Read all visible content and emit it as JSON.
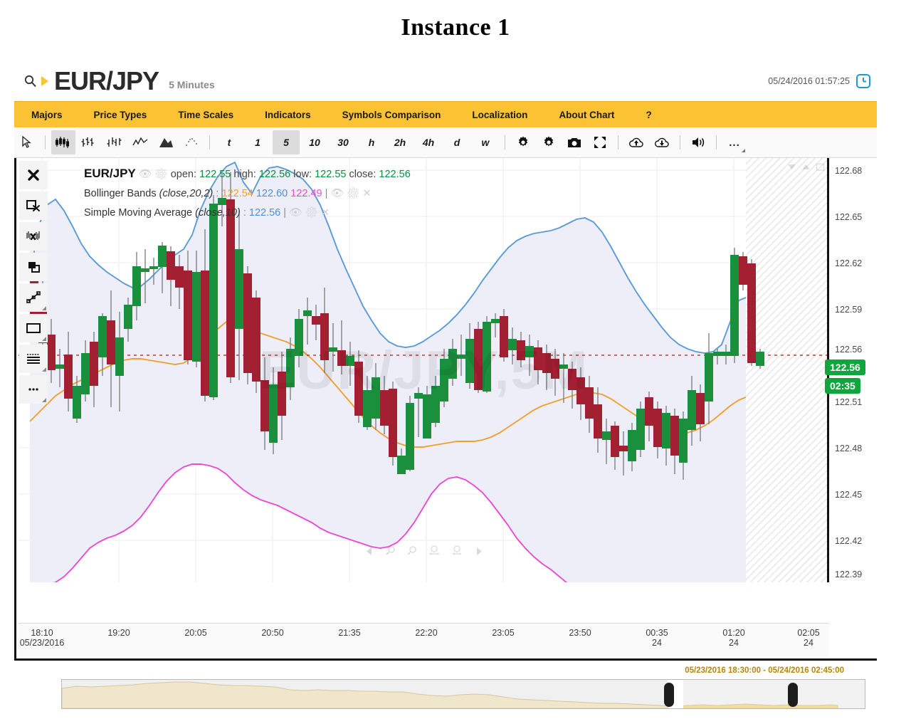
{
  "page": {
    "title": "Instance 1"
  },
  "header": {
    "search_icon": "magnifier-icon",
    "symbol": "EUR/JPY",
    "period": "5 Minutes",
    "datetime": "05/24/2016 01:57:25",
    "clock_icon": "clock-icon"
  },
  "menu": {
    "items": [
      {
        "label": "Majors"
      },
      {
        "label": "Price Types"
      },
      {
        "label": "Time Scales"
      },
      {
        "label": "Indicators"
      },
      {
        "label": "Symbols Comparison"
      },
      {
        "label": "Localization"
      },
      {
        "label": "About Chart"
      },
      {
        "label": "?"
      }
    ]
  },
  "toolbar": {
    "tools": [
      {
        "name": "cursor-icon",
        "label": "",
        "selected": false
      },
      {
        "name": "candlestick-icon",
        "label": "",
        "selected": true
      },
      {
        "name": "ohlc-bars-icon",
        "label": "",
        "selected": false
      },
      {
        "name": "hlc-bars-icon",
        "label": "",
        "selected": false
      },
      {
        "name": "line-chart-icon",
        "label": "",
        "selected": false
      },
      {
        "name": "mountain-chart-icon",
        "label": "",
        "selected": false
      },
      {
        "name": "scatter-chart-icon",
        "label": "",
        "selected": false
      }
    ],
    "timeframes": [
      {
        "label": "t",
        "selected": false
      },
      {
        "label": "1",
        "selected": false
      },
      {
        "label": "5",
        "selected": true
      },
      {
        "label": "10",
        "selected": false
      },
      {
        "label": "30",
        "selected": false
      },
      {
        "label": "h",
        "selected": false
      },
      {
        "label": "2h",
        "selected": false
      },
      {
        "label": "4h",
        "selected": false
      },
      {
        "label": "d",
        "selected": false
      },
      {
        "label": "w",
        "selected": false
      }
    ],
    "actions": [
      {
        "name": "settings-gear-icon"
      },
      {
        "name": "chart-settings-gear-icon"
      },
      {
        "name": "camera-snapshot-icon"
      },
      {
        "name": "fullscreen-icon"
      },
      {
        "name": "cloud-upload-icon"
      },
      {
        "name": "cloud-download-icon"
      },
      {
        "name": "alerts-icon"
      }
    ],
    "more_label": "..."
  },
  "drawing_tools": [
    {
      "name": "delete-all-icon",
      "glyph": "✖"
    },
    {
      "name": "delete-selected-icon",
      "glyph": ""
    },
    {
      "name": "remove-indicators-icon",
      "glyph": ""
    },
    {
      "name": "clone-icon",
      "glyph": ""
    },
    {
      "name": "trend-line-icon",
      "glyph": ""
    },
    {
      "name": "rectangle-icon",
      "glyph": ""
    },
    {
      "name": "fibonacci-icon",
      "glyph": ""
    },
    {
      "name": "more-tools-icon",
      "glyph": "•••"
    }
  ],
  "legend": {
    "symbol": "EUR/JPY",
    "ohlc": {
      "open_label": "open:",
      "open": "122.55",
      "high_label": "high:",
      "high": "122.56",
      "low_label": "low:",
      "low": "122.55",
      "close_label": "close:",
      "close": "122.56"
    },
    "bollinger": {
      "name": "Bollinger Bands",
      "params": "(close,20,2)",
      "middle": "122.54",
      "upper": "122.60",
      "lower": "122.49"
    },
    "sma": {
      "name": "Simple Moving Average",
      "params": "(close,10)",
      "value": "122.56"
    }
  },
  "watermark": "EUR/JPY,5M",
  "price_axis": {
    "ticks": [
      "122.68",
      "122.65",
      "122.62",
      "122.59",
      "122.56",
      "122.51",
      "122.48",
      "122.45",
      "122.42",
      "122.39"
    ],
    "current_price": "122.56",
    "countdown": "02:35",
    "badge_color": "#11a63d"
  },
  "time_axis": {
    "ticks": [
      {
        "time": "18:10",
        "sub": "05/23/2016"
      },
      {
        "time": "19:20",
        "sub": ""
      },
      {
        "time": "20:05",
        "sub": ""
      },
      {
        "time": "20:50",
        "sub": ""
      },
      {
        "time": "21:35",
        "sub": ""
      },
      {
        "time": "22:20",
        "sub": ""
      },
      {
        "time": "23:05",
        "sub": ""
      },
      {
        "time": "23:50",
        "sub": ""
      },
      {
        "time": "00:35",
        "sub": "24"
      },
      {
        "time": "01:20",
        "sub": "24"
      },
      {
        "time": "02:05",
        "sub": "24"
      }
    ]
  },
  "navigator": {
    "range_label": "05/23/2016 18:30:00 - 05/24/2016 02:45:00"
  },
  "zoom_controls": [
    {
      "name": "scroll-left-icon"
    },
    {
      "name": "zoom-in-icon"
    },
    {
      "name": "zoom-out-icon"
    },
    {
      "name": "zoom-fit-icon"
    },
    {
      "name": "zoom-reset-icon"
    },
    {
      "name": "scroll-right-icon"
    }
  ],
  "corner_icons": [
    {
      "name": "collapse-icon"
    },
    {
      "name": "expand-icon"
    },
    {
      "name": "maximize-icon"
    }
  ],
  "colors": {
    "accent": "#fbc234",
    "bull": "#1a8f3c",
    "bear": "#a31f32",
    "bollinger_band": "#5b9bd5",
    "bollinger_lower": "#ec4bd0",
    "sma": "#f0a030",
    "band_fill": "#ececf8",
    "current_price_line": "#c0392b"
  },
  "chart_data": {
    "type": "candlestick",
    "title": "EUR/JPY 5 Minutes",
    "xlabel": "",
    "ylabel": "",
    "ylim": [
      122.39,
      122.695
    ],
    "grid": true,
    "price_ticks": [
      122.68,
      122.65,
      122.62,
      122.59,
      122.56,
      122.51,
      122.48,
      122.45,
      122.42,
      122.39
    ],
    "current_price": 122.56,
    "candles": [
      {
        "t": "18:10",
        "o": 122.615,
        "h": 122.645,
        "l": 122.575,
        "c": 122.578
      },
      {
        "t": "18:15",
        "o": 122.592,
        "h": 122.598,
        "l": 122.545,
        "c": 122.556
      },
      {
        "t": "18:20",
        "o": 122.565,
        "h": 122.57,
        "l": 122.53,
        "c": 122.54
      },
      {
        "t": "18:25",
        "o": 122.54,
        "h": 122.545,
        "l": 122.528,
        "c": 122.538
      },
      {
        "t": "18:30",
        "o": 122.553,
        "h": 122.56,
        "l": 122.518,
        "c": 122.521
      },
      {
        "t": "18:35",
        "o": 122.521,
        "h": 122.545,
        "l": 122.507,
        "c": 122.536
      },
      {
        "t": "18:40",
        "o": 122.536,
        "h": 122.56,
        "l": 122.515,
        "c": 122.558
      },
      {
        "t": "18:45",
        "o": 122.558,
        "h": 122.568,
        "l": 122.523,
        "c": 122.53
      },
      {
        "t": "18:50",
        "o": 122.578,
        "h": 122.59,
        "l": 122.555,
        "c": 122.59
      },
      {
        "t": "18:55",
        "o": 122.561,
        "h": 122.6,
        "l": 122.516,
        "c": 122.527
      },
      {
        "t": "19:00",
        "o": 122.527,
        "h": 122.562,
        "l": 122.516,
        "c": 122.558
      },
      {
        "t": "19:05",
        "o": 122.558,
        "h": 122.583,
        "l": 122.553,
        "c": 122.578
      },
      {
        "t": "19:10",
        "o": 122.578,
        "h": 122.62,
        "l": 122.57,
        "c": 122.596
      },
      {
        "t": "19:15",
        "o": 122.596,
        "h": 122.622,
        "l": 122.586,
        "c": 122.598
      },
      {
        "t": "19:20",
        "o": 122.598,
        "h": 122.602,
        "l": 122.59,
        "c": 122.6
      },
      {
        "t": "19:25",
        "o": 122.615,
        "h": 122.628,
        "l": 122.594,
        "c": 122.598
      },
      {
        "t": "19:30",
        "o": 122.609,
        "h": 122.62,
        "l": 122.578,
        "c": 122.585
      },
      {
        "t": "19:35",
        "o": 122.6,
        "h": 122.612,
        "l": 122.584,
        "c": 122.588
      },
      {
        "t": "19:40",
        "o": 122.586,
        "h": 122.6,
        "l": 122.52,
        "c": 122.526
      },
      {
        "t": "19:45",
        "o": 122.526,
        "h": 122.6,
        "l": 122.52,
        "c": 122.594
      },
      {
        "t": "19:50",
        "o": 122.53,
        "h": 122.6,
        "l": 122.498,
        "c": 122.596
      },
      {
        "t": "19:55",
        "o": 122.596,
        "h": 122.66,
        "l": 122.495,
        "c": 122.636
      },
      {
        "t": "20:00",
        "o": 122.636,
        "h": 122.66,
        "l": 122.618,
        "c": 122.638
      },
      {
        "t": "20:05",
        "o": 122.636,
        "h": 122.665,
        "l": 122.494,
        "c": 122.5
      },
      {
        "t": "20:10",
        "o": 122.596,
        "h": 122.62,
        "l": 122.5,
        "c": 122.565
      },
      {
        "t": "20:15",
        "o": 122.565,
        "h": 122.58,
        "l": 122.5,
        "c": 122.512
      },
      {
        "t": "20:20",
        "o": 122.558,
        "h": 122.566,
        "l": 122.504,
        "c": 122.508
      },
      {
        "t": "20:25",
        "o": 122.508,
        "h": 122.53,
        "l": 122.47,
        "c": 122.476
      },
      {
        "t": "20:30",
        "o": 122.498,
        "h": 122.536,
        "l": 122.466,
        "c": 122.53
      },
      {
        "t": "20:35",
        "o": 122.53,
        "h": 122.545,
        "l": 122.484,
        "c": 122.512
      },
      {
        "t": "20:40",
        "o": 122.537,
        "h": 122.56,
        "l": 122.512,
        "c": 122.556
      },
      {
        "t": "20:45",
        "o": 122.556,
        "h": 122.59,
        "l": 122.548,
        "c": 122.578
      },
      {
        "t": "20:50",
        "o": 122.578,
        "h": 122.58,
        "l": 122.562,
        "c": 122.566
      },
      {
        "t": "20:55",
        "o": 122.573,
        "h": 122.58,
        "l": 122.548,
        "c": 122.552
      },
      {
        "t": "21:00",
        "o": 122.552,
        "h": 122.592,
        "l": 122.524,
        "c": 122.528
      },
      {
        "t": "21:05",
        "o": 122.528,
        "h": 122.54,
        "l": 122.521,
        "c": 122.526
      },
      {
        "t": "21:10",
        "o": 122.548,
        "h": 122.59,
        "l": 122.516,
        "c": 122.522
      },
      {
        "t": "21:15",
        "o": 122.536,
        "h": 122.545,
        "l": 122.502,
        "c": 122.508
      },
      {
        "t": "21:20",
        "o": 122.528,
        "h": 122.535,
        "l": 122.488,
        "c": 122.494
      },
      {
        "t": "21:25",
        "o": 122.494,
        "h": 122.522,
        "l": 122.48,
        "c": 122.508
      },
      {
        "t": "21:30",
        "o": 122.508,
        "h": 122.52,
        "l": 122.492,
        "c": 122.496
      },
      {
        "t": "21:35",
        "o": 122.512,
        "h": 122.52,
        "l": 122.484,
        "c": 122.49
      },
      {
        "t": "21:40",
        "o": 122.506,
        "h": 122.512,
        "l": 122.44,
        "c": 122.444
      },
      {
        "t": "21:45",
        "o": 122.45,
        "h": 122.46,
        "l": 122.438,
        "c": 122.448
      },
      {
        "t": "21:50",
        "o": 122.448,
        "h": 122.5,
        "l": 122.442,
        "c": 122.498
      },
      {
        "t": "21:55",
        "o": 122.498,
        "h": 122.518,
        "l": 122.484,
        "c": 122.516
      },
      {
        "t": "22:00",
        "o": 122.516,
        "h": 122.54,
        "l": 122.5,
        "c": 122.518
      },
      {
        "t": "22:05",
        "o": 122.518,
        "h": 122.53,
        "l": 122.505,
        "c": 122.528
      },
      {
        "t": "22:10",
        "o": 122.52,
        "h": 122.548,
        "l": 122.496,
        "c": 122.544
      },
      {
        "t": "22:15",
        "o": 122.544,
        "h": 122.56,
        "l": 122.512,
        "c": 122.556
      },
      {
        "t": "22:20",
        "o": 122.556,
        "h": 122.568,
        "l": 122.54,
        "c": 122.548
      },
      {
        "t": "22:25",
        "o": 122.548,
        "h": 122.56,
        "l": 122.536,
        "c": 122.556
      },
      {
        "t": "22:30",
        "o": 122.556,
        "h": 122.578,
        "l": 122.5,
        "c": 122.506
      },
      {
        "t": "22:35",
        "o": 122.506,
        "h": 122.578,
        "l": 122.5,
        "c": 122.572
      },
      {
        "t": "22:40",
        "o": 122.572,
        "h": 122.6,
        "l": 122.56,
        "c": 122.596
      },
      {
        "t": "22:45",
        "o": 122.596,
        "h": 122.6,
        "l": 122.592,
        "c": 122.598
      },
      {
        "t": "22:50",
        "o": 122.598,
        "h": 122.602,
        "l": 122.544,
        "c": 122.548
      },
      {
        "t": "22:55",
        "o": 122.548,
        "h": 122.572,
        "l": 122.54,
        "c": 122.568
      },
      {
        "t": "23:00",
        "o": 122.568,
        "h": 122.576,
        "l": 122.548,
        "c": 122.552
      },
      {
        "t": "23:05",
        "o": 122.576,
        "h": 122.6,
        "l": 122.54,
        "c": 122.57
      },
      {
        "t": "23:10",
        "o": 122.57,
        "h": 122.578,
        "l": 122.548,
        "c": 122.552
      },
      {
        "t": "23:15",
        "o": 122.556,
        "h": 122.572,
        "l": 122.542,
        "c": 122.568
      },
      {
        "t": "23:20",
        "o": 122.568,
        "h": 122.572,
        "l": 122.55,
        "c": 122.556
      },
      {
        "t": "23:25",
        "o": 122.556,
        "h": 122.56,
        "l": 122.534,
        "c": 122.538
      },
      {
        "t": "23:30",
        "o": 122.54,
        "h": 122.548,
        "l": 122.526,
        "c": 122.53
      },
      {
        "t": "23:35",
        "o": 122.53,
        "h": 122.542,
        "l": 122.52,
        "c": 122.524
      },
      {
        "t": "23:40",
        "o": 122.528,
        "h": 122.535,
        "l": 122.51,
        "c": 122.514
      },
      {
        "t": "23:45",
        "o": 122.514,
        "h": 122.52,
        "l": 122.496,
        "c": 122.5
      },
      {
        "t": "23:50",
        "o": 122.502,
        "h": 122.508,
        "l": 122.49,
        "c": 122.494
      },
      {
        "t": "23:55",
        "o": 122.498,
        "h": 122.504,
        "l": 122.492,
        "c": 122.496
      },
      {
        "t": "00:00",
        "o": 122.496,
        "h": 122.514,
        "l": 122.49,
        "c": 122.512
      },
      {
        "t": "00:05",
        "o": 122.512,
        "h": 122.536,
        "l": 122.506,
        "c": 122.532
      },
      {
        "t": "00:10",
        "o": 122.532,
        "h": 122.538,
        "l": 122.508,
        "c": 122.512
      },
      {
        "t": "00:15",
        "o": 122.514,
        "h": 122.52,
        "l": 122.494,
        "c": 122.498
      },
      {
        "t": "00:20",
        "o": 122.512,
        "h": 122.518,
        "l": 122.494,
        "c": 122.516
      },
      {
        "t": "00:25",
        "o": 122.516,
        "h": 122.522,
        "l": 122.498,
        "c": 122.502
      },
      {
        "t": "00:30",
        "o": 122.502,
        "h": 122.51,
        "l": 122.486,
        "c": 122.49
      },
      {
        "t": "00:35",
        "o": 122.496,
        "h": 122.516,
        "l": 122.486,
        "c": 122.512
      },
      {
        "t": "00:40",
        "o": 122.512,
        "h": 122.552,
        "l": 122.504,
        "c": 122.53
      },
      {
        "t": "00:45",
        "o": 122.53,
        "h": 122.548,
        "l": 122.504,
        "c": 122.51
      },
      {
        "t": "00:50",
        "o": 122.51,
        "h": 122.56,
        "l": 122.506,
        "c": 122.556
      },
      {
        "t": "00:55",
        "o": 122.556,
        "h": 122.56,
        "l": 122.548,
        "c": 122.552
      },
      {
        "t": "01:00",
        "o": 122.552,
        "h": 122.56,
        "l": 122.544,
        "c": 122.556
      },
      {
        "t": "01:05",
        "o": 122.556,
        "h": 122.562,
        "l": 122.55,
        "c": 122.554
      },
      {
        "t": "01:10",
        "o": 122.556,
        "h": 122.62,
        "l": 122.552,
        "c": 122.616
      },
      {
        "t": "01:15",
        "o": 122.618,
        "h": 122.622,
        "l": 122.592,
        "c": 122.598
      },
      {
        "t": "01:20",
        "o": 122.606,
        "h": 122.61,
        "l": 122.548,
        "c": 122.552
      },
      {
        "t": "01:25",
        "o": 122.552,
        "h": 122.562,
        "l": 122.548,
        "c": 122.558
      }
    ],
    "series": [
      {
        "name": "Bollinger Upper",
        "color": "#5b9bd5"
      },
      {
        "name": "Bollinger Middle / SMA(10)",
        "color": "#f0a030"
      },
      {
        "name": "Bollinger Lower",
        "color": "#ec4bd0"
      }
    ]
  }
}
